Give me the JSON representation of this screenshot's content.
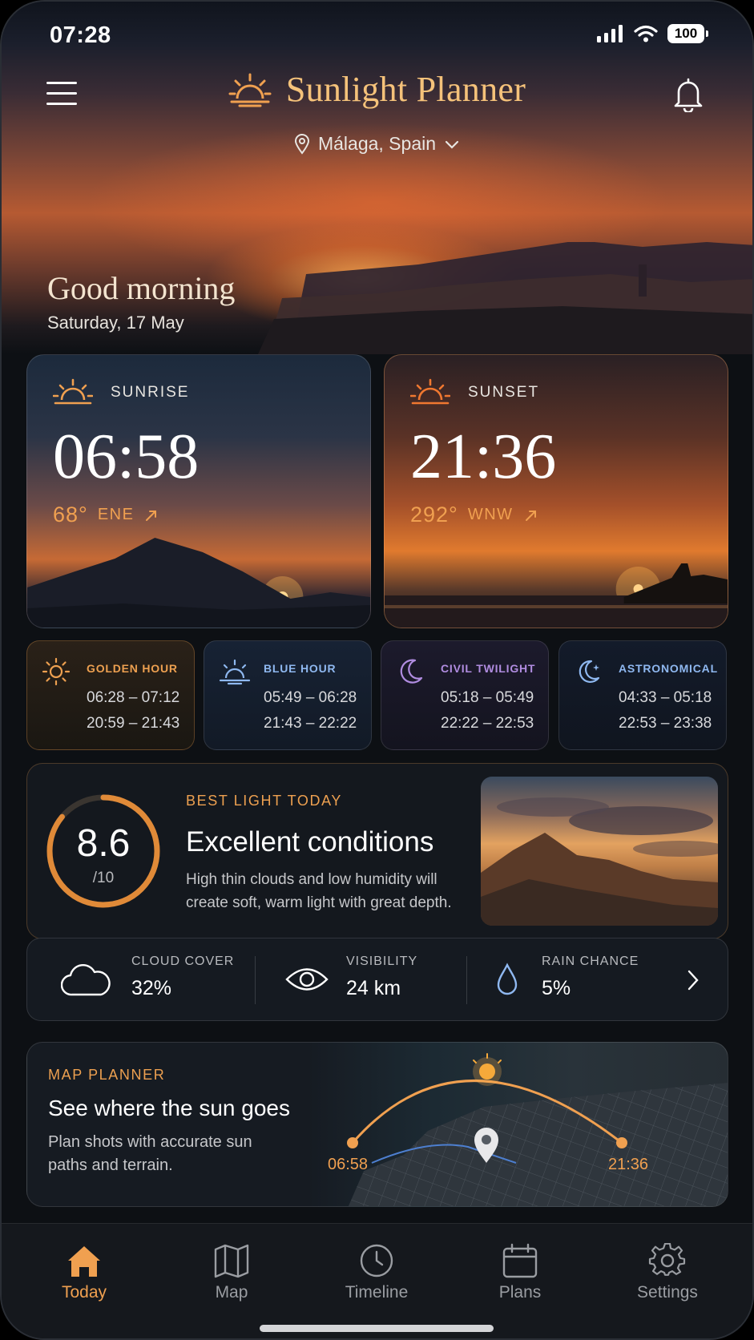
{
  "status": {
    "time": "07:28",
    "battery": "100"
  },
  "header": {
    "title": "Sunlight Planner",
    "location": "Málaga, Spain"
  },
  "greeting": {
    "title": "Good morning",
    "date": "Saturday, 17 May"
  },
  "sunrise": {
    "label": "SUNRISE",
    "time": "06:58",
    "degrees": "68°",
    "direction": "ENE"
  },
  "sunset": {
    "label": "SUNSET",
    "time": "21:36",
    "degrees": "292°",
    "direction": "WNW"
  },
  "phases": [
    {
      "label": "GOLDEN HOUR",
      "morning": "06:28 – 07:12",
      "evening": "20:59 – 21:43",
      "color": "#eda050"
    },
    {
      "label": "BLUE HOUR",
      "morning": "05:49 – 06:28",
      "evening": "21:43 – 22:22",
      "color": "#8fb8f0"
    },
    {
      "label": "CIVIL TWILIGHT",
      "morning": "05:18 – 05:49",
      "evening": "22:22 – 22:53",
      "color": "#b08ce0"
    },
    {
      "label": "ASTRONOMICAL",
      "morning": "04:33 – 05:18",
      "evening": "22:53 – 23:38",
      "color": "#8fb8f0"
    }
  ],
  "best_light": {
    "label": "BEST LIGHT TODAY",
    "score": "8.6",
    "score_max": "/10",
    "score_fraction": 0.86,
    "title": "Excellent conditions",
    "description": "High thin clouds and low humidity will create soft, warm light with great depth."
  },
  "weather": {
    "cloud": {
      "label": "CLOUD COVER",
      "value": "32%"
    },
    "visibility": {
      "label": "VISIBILITY",
      "value": "24 km"
    },
    "rain": {
      "label": "RAIN CHANCE",
      "value": "5%"
    }
  },
  "map_planner": {
    "label": "MAP PLANNER",
    "title": "See where the sun goes",
    "description": "Plan shots with accurate sun paths and terrain.",
    "start": "06:58",
    "end": "21:36"
  },
  "tabs": [
    {
      "label": "Today",
      "icon": "home-icon",
      "active": true
    },
    {
      "label": "Map",
      "icon": "map-icon",
      "active": false
    },
    {
      "label": "Timeline",
      "icon": "clock-icon",
      "active": false
    },
    {
      "label": "Plans",
      "icon": "calendar-icon",
      "active": false
    },
    {
      "label": "Settings",
      "icon": "gear-icon",
      "active": false
    }
  ],
  "colors": {
    "accent": "#f0a050",
    "title_gold": "#f5c27a",
    "background": "#0d1014"
  }
}
